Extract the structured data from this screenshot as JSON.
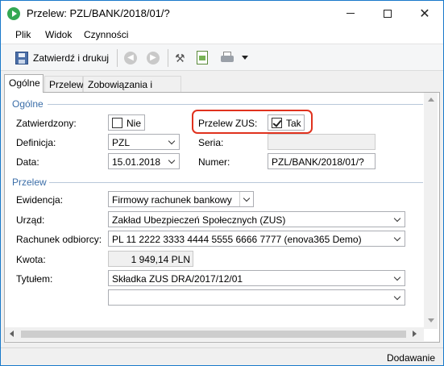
{
  "window": {
    "title": "Przelew: PZL/BANK/2018/01/?",
    "minimize_glyph": "",
    "close_glyph": "✕"
  },
  "menu": [
    "Plik",
    "Widok",
    "Czynności"
  ],
  "toolbar": {
    "save_label": "Zatwierdź i drukuj",
    "tools_glyph": "⚒"
  },
  "tabs": [
    {
      "label": "Ogólne",
      "active": true
    },
    {
      "label": "Przelew",
      "active": false
    },
    {
      "label": "Zobowiązania i wpłaty",
      "active": false
    }
  ],
  "sections": {
    "general": "Ogólne",
    "transfer": "Przelew"
  },
  "general": {
    "approved_label": "Zatwierdzony:",
    "approved_value": "Nie",
    "approved_checked": false,
    "zus_label": "Przelew ZUS:",
    "zus_value": "Tak",
    "zus_checked": true,
    "definition_label": "Definicja:",
    "definition_value": "PZL",
    "series_label": "Seria:",
    "series_value": "",
    "date_label": "Data:",
    "date_value": "15.01.2018",
    "number_label": "Numer:",
    "number_value": "PZL/BANK/2018/01/?"
  },
  "transfer": {
    "register_label": "Ewidencja:",
    "register_value": "Firmowy rachunek bankowy",
    "office_label": "Urząd:",
    "office_value": "Zakład Ubezpieczeń Społecznych (ZUS)",
    "account_label": "Rachunek odbiorcy:",
    "account_value": "PL 11 2222 3333 4444 5555 6666 7777 (enova365 Demo)",
    "amount_label": "Kwota:",
    "amount_value": "1 949,14 PLN",
    "title_label": "Tytułem:",
    "title_value": "Składka ZUS DRA/2017/12/01",
    "title_value2": ""
  },
  "status": {
    "mode": "Dodawanie"
  },
  "colors": {
    "accent": "#1979ca",
    "section": "#3b6ea8",
    "highlight": "#e0321e"
  }
}
